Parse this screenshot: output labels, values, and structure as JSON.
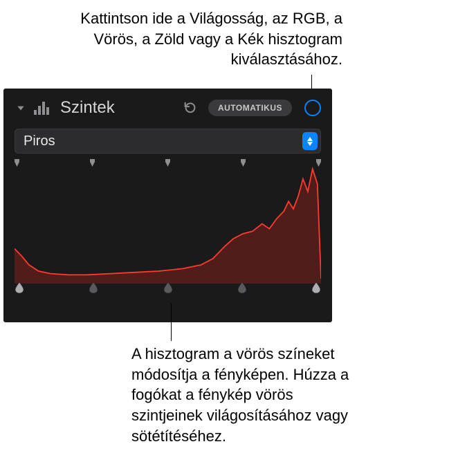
{
  "callouts": {
    "top": "Kattintson ide a Világosság, az RGB, a Vörös, a Zöld vagy a Kék hisztogram kiválasztásához.",
    "bottom": "A hisztogram a vörös színeket módosítja a fényképen. Húzza a fogókat a fénykép vörös szintjeinek világosításához vagy sötétítéséhez."
  },
  "panel": {
    "title": "Szintek",
    "auto_label": "AUTOMATIKUS",
    "channel_selected": "Piros"
  },
  "chart_data": {
    "type": "area",
    "title": "",
    "xlabel": "",
    "ylabel": "",
    "xlim": [
      0,
      255
    ],
    "ylim": [
      0,
      100
    ],
    "series": [
      {
        "name": "Piros",
        "color": "#ff3b30",
        "x": [
          0,
          6,
          12,
          20,
          30,
          45,
          60,
          80,
          100,
          120,
          140,
          155,
          165,
          175,
          182,
          190,
          198,
          206,
          212,
          218,
          224,
          228,
          232,
          236,
          240,
          244,
          248,
          252,
          255
        ],
        "values": [
          28,
          22,
          15,
          10,
          8,
          7,
          7,
          8,
          9,
          10,
          12,
          15,
          20,
          30,
          36,
          40,
          42,
          48,
          44,
          52,
          58,
          66,
          60,
          70,
          84,
          74,
          92,
          80,
          4
        ]
      }
    ]
  },
  "handles": {
    "top_count": 5,
    "bottom_count": 5
  }
}
